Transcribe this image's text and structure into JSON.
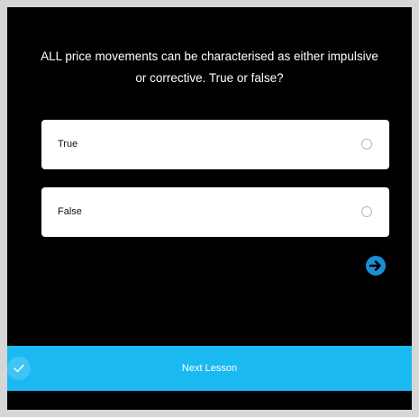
{
  "quiz": {
    "question": "ALL price movements can be characterised as either impulsive or corrective. True or false?",
    "options": [
      {
        "label": "True",
        "selected": false
      },
      {
        "label": "False",
        "selected": false
      }
    ],
    "next_icon": "arrow-right-circle-icon"
  },
  "footer": {
    "next_lesson_label": "Next Lesson",
    "completed_icon": "checkmark-icon"
  },
  "colors": {
    "background": "#000000",
    "accent": "#1bb9f2",
    "arrow": "#1a8fd1",
    "option_bg": "#ffffff"
  }
}
